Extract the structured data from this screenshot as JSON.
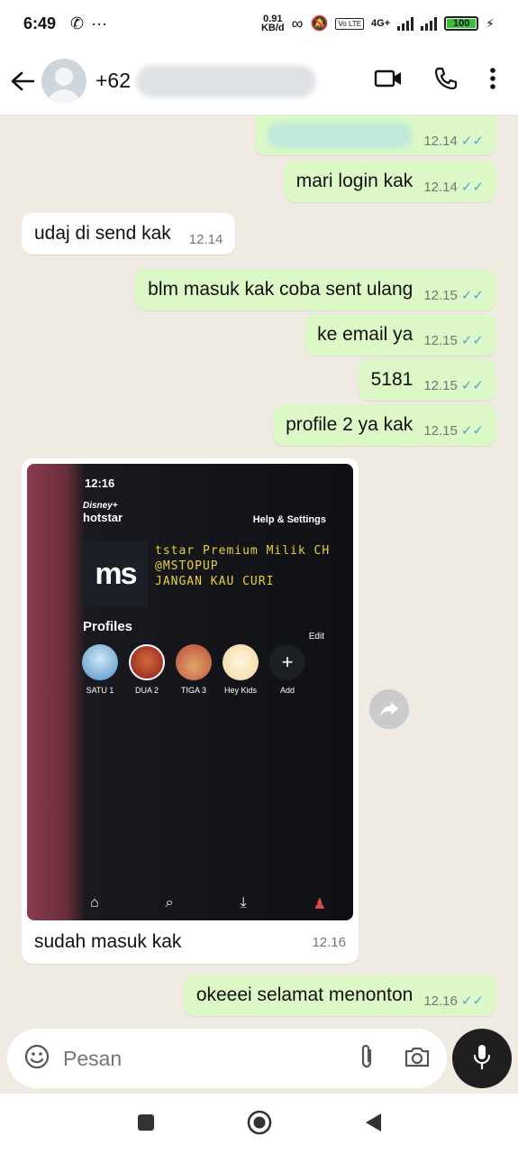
{
  "status_bar": {
    "time": "6:49",
    "net_speed_value": "0.91",
    "net_speed_unit": "KB/d",
    "volte": "Vo LTE",
    "network": "4G+",
    "battery": "100"
  },
  "header": {
    "contact_prefix": "+62"
  },
  "messages": [
    {
      "text": "",
      "time": "12.14"
    },
    {
      "text": "mari login kak",
      "time": "12.14"
    },
    {
      "text": "udaj di send kak",
      "time": "12.14"
    },
    {
      "text": "blm masuk kak coba sent ulang",
      "time": "12.15"
    },
    {
      "text": "ke email ya",
      "time": "12.15"
    },
    {
      "text": "5181",
      "time": "12.15"
    },
    {
      "text": "profile 2 ya kak",
      "time": "12.15"
    },
    {
      "text": "sudah masuk kak",
      "time": "12.16"
    },
    {
      "text": "okeeei selamat menonton",
      "time": "12.16"
    }
  ],
  "photo": {
    "phone_time": "12:16",
    "brand_top": "Disney+",
    "brand": "hotstar",
    "help": "Help & Settings",
    "logo": "ms",
    "watermark": [
      "tstar Premium Milik CH",
      "@MSTOPUP",
      "JANGAN KAU CURI"
    ],
    "profiles_heading": "Profiles",
    "edit": "Edit",
    "profiles": [
      "SATU 1",
      "DUA 2",
      "TIGA 3",
      "Hey Kids",
      "Add"
    ]
  },
  "composer": {
    "placeholder": "Pesan"
  },
  "icons": {
    "back": "arrow-left-icon",
    "video": "video-call-icon",
    "call": "phone-icon",
    "menu": "more-vert-icon",
    "emoji": "emoji-icon",
    "attach": "paperclip-icon",
    "camera": "camera-icon",
    "mic": "mic-icon",
    "forward": "forward-icon"
  },
  "colors": {
    "outgoing_bubble": "#dcf8c6",
    "incoming_bubble": "#ffffff",
    "read_ticks": "#4fa3e0",
    "chat_background": "#efeae2"
  }
}
